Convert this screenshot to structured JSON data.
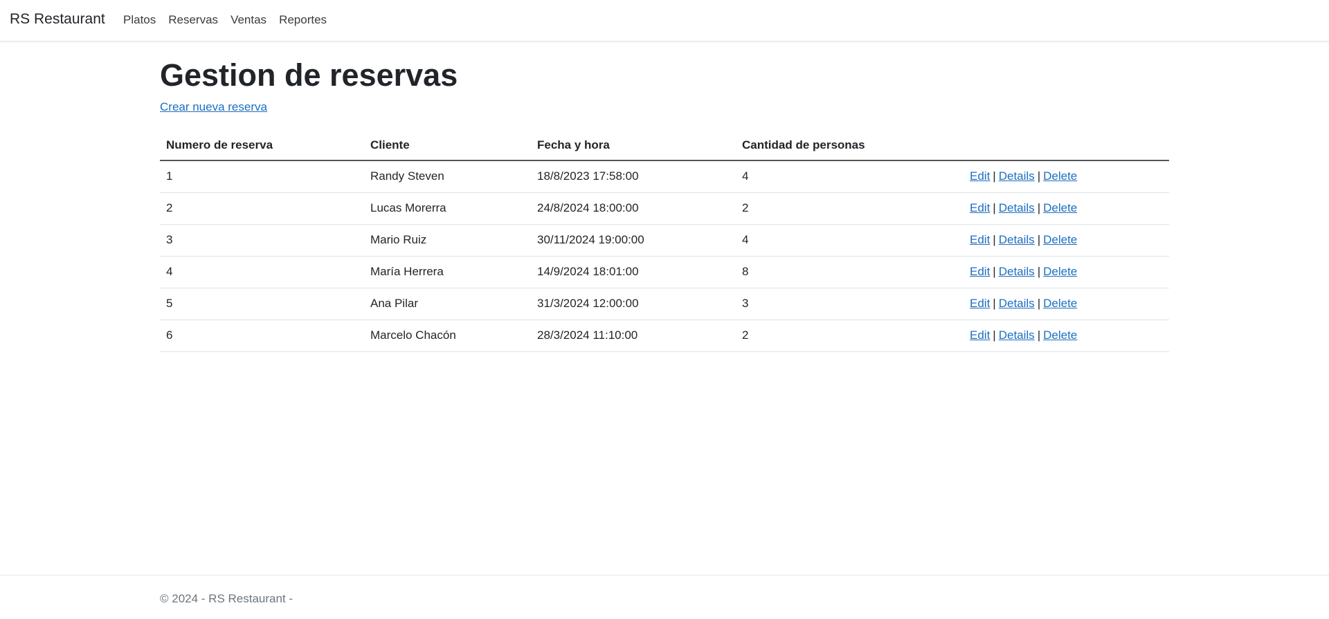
{
  "navbar": {
    "brand": "RS Restaurant",
    "links": [
      "Platos",
      "Reservas",
      "Ventas",
      "Reportes"
    ]
  },
  "main": {
    "title": "Gestion de reservas",
    "create_link": "Crear nueva reserva",
    "table": {
      "headers": [
        "Numero de reserva",
        "Cliente",
        "Fecha y hora",
        "Cantidad de personas",
        ""
      ],
      "rows": [
        {
          "num": "1",
          "cliente": "Randy Steven",
          "fecha": "18/8/2023 17:58:00",
          "cantidad": "4"
        },
        {
          "num": "2",
          "cliente": "Lucas Morerra",
          "fecha": "24/8/2024 18:00:00",
          "cantidad": "2"
        },
        {
          "num": "3",
          "cliente": "Mario Ruiz",
          "fecha": "30/11/2024 19:00:00",
          "cantidad": "4"
        },
        {
          "num": "4",
          "cliente": "María Herrera",
          "fecha": "14/9/2024 18:01:00",
          "cantidad": "8"
        },
        {
          "num": "5",
          "cliente": "Ana Pilar",
          "fecha": "31/3/2024 12:00:00",
          "cantidad": "3"
        },
        {
          "num": "6",
          "cliente": "Marcelo Chacón",
          "fecha": "28/3/2024 11:10:00",
          "cantidad": "2"
        }
      ],
      "actions": {
        "edit": "Edit",
        "details": "Details",
        "delete": "Delete",
        "separator": "|"
      }
    }
  },
  "footer": {
    "text": "© 2024 - RS Restaurant -"
  },
  "colors": {
    "link": "#1b6ec2",
    "text": "#212529",
    "muted": "#6c757d"
  }
}
